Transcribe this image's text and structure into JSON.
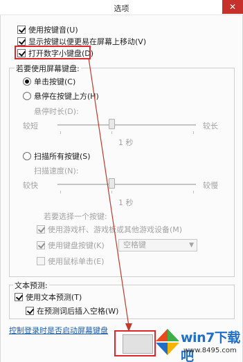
{
  "window": {
    "title": "选项",
    "close_glyph": "✕"
  },
  "checkboxes": [
    {
      "label": "使用按键音(U)",
      "checked": true
    },
    {
      "label": "显示按键以便更易在屏幕上移动(V)",
      "checked": true
    },
    {
      "label": "打开数字小键盘(D)",
      "checked": true
    }
  ],
  "screen_keyboard": {
    "group_label": "若要使用屏幕键盘:",
    "click_keys_label": "单击按键(C)",
    "hover_label": "悬停在按键上方(H)",
    "hover_duration_label": "悬停时长(D):",
    "hover_min": "较短",
    "hover_max": "较长",
    "hover_value": "1 秒",
    "scan_label": "扫描所有按键(S)",
    "scan_speed_label": "扫描速度(N):",
    "scan_min": "较快",
    "scan_max": "较慢",
    "scan_value": "1 秒",
    "select_key_label": "若要选择一个按键:",
    "use_gamepad_label": "使用游戏杆、游戏板或其他游戏设备(M)",
    "use_keyboard_key_label": "使用键盘按键(K)",
    "keyboard_key_value": "空格键",
    "use_mouse_click_label": "使用鼠标单击(E)"
  },
  "text_prediction": {
    "group_label": "文本预测:",
    "use_prediction_label": "使用文本预测(T)",
    "insert_space_label": "在预测词后插入空格(W)"
  },
  "footer": {
    "link_text": "控制登录时是否启动屏幕键盘"
  },
  "watermark": {
    "text": "win7下载吧",
    "url": "www.8495.com"
  },
  "colors": {
    "highlight": "#e0262b",
    "arrow": "#c0392b",
    "link": "#1a5fb4"
  }
}
